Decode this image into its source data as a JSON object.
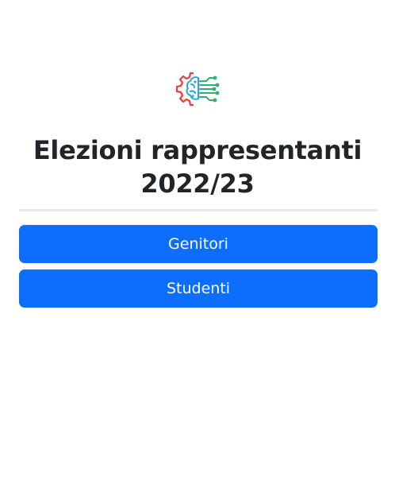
{
  "logo": {
    "icon": "brain-circuit-gear-icon",
    "colors": {
      "gear": "#e8403a",
      "brain": "#2aa9d8",
      "circuit": "#2fb36b"
    }
  },
  "header": {
    "title_line1": "Elezioni rappresentanti",
    "title_line2": "2022/23"
  },
  "actions": {
    "genitori_label": "Genitori",
    "studenti_label": "Studenti"
  },
  "theme": {
    "primary": "#0d6efd",
    "text": "#212529",
    "divider": "#e7e8ea"
  }
}
